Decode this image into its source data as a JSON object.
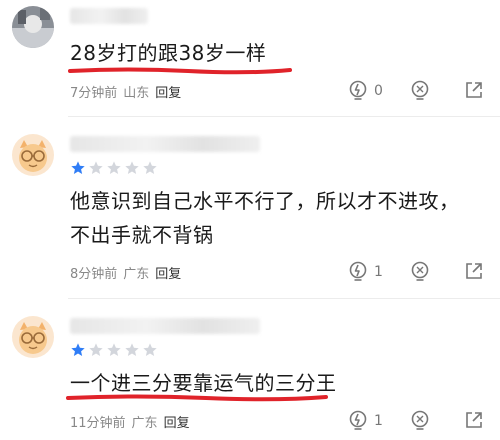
{
  "comments": [
    {
      "text": "28岁打的跟38岁一样",
      "time": "7分钟前",
      "location": "山东",
      "reply": "回复",
      "like_count": "0",
      "stars": 0
    },
    {
      "text_line1": "他意识到自己水平不行了，所以才不进攻，",
      "text_line2": "不出手就不背锅",
      "time": "8分钟前",
      "location": "广东",
      "reply": "回复",
      "like_count": "1",
      "stars": 1
    },
    {
      "text": "一个进三分要靠运气的三分王",
      "time": "11分钟前",
      "location": "广东",
      "reply": "回复",
      "like_count": "1",
      "stars": 1
    }
  ],
  "colors": {
    "underline": "#e0232a",
    "star_filled": "#2f7df6",
    "star_empty": "#d3d6dc",
    "meta": "#888888"
  }
}
